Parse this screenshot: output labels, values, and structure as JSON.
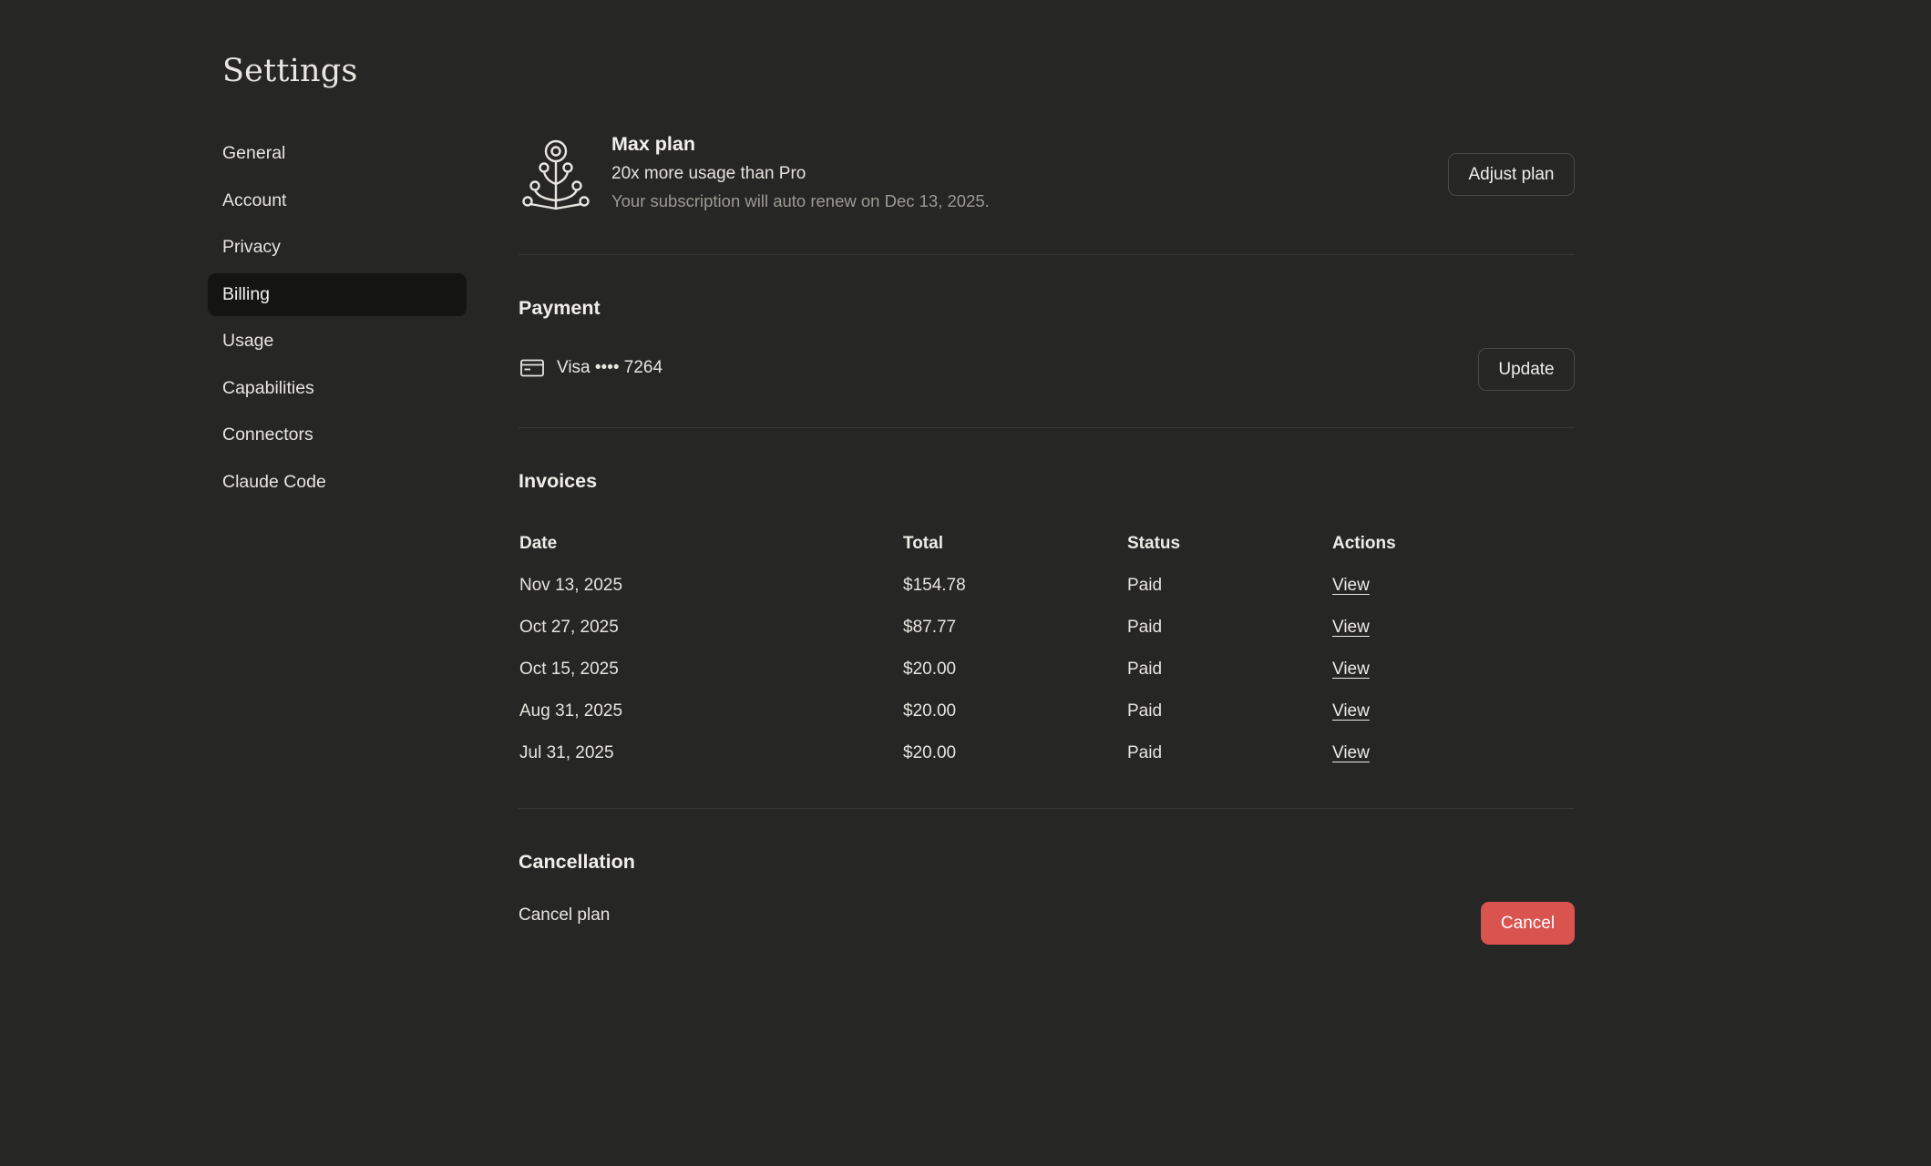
{
  "page": {
    "title": "Settings"
  },
  "sidebar": {
    "items": [
      {
        "label": "General"
      },
      {
        "label": "Account"
      },
      {
        "label": "Privacy"
      },
      {
        "label": "Billing"
      },
      {
        "label": "Usage"
      },
      {
        "label": "Capabilities"
      },
      {
        "label": "Connectors"
      },
      {
        "label": "Claude Code"
      }
    ],
    "active_item": "Billing"
  },
  "plan": {
    "name": "Max plan",
    "description": "20x more usage than Pro",
    "renewal": "Your subscription will auto renew on Dec 13, 2025.",
    "adjust_label": "Adjust plan",
    "icon": "plan-tree-icon"
  },
  "payment": {
    "title": "Payment",
    "card_icon": "credit-card-icon",
    "card_text": "Visa •••• 7264",
    "update_label": "Update"
  },
  "invoices": {
    "title": "Invoices",
    "headers": {
      "date": "Date",
      "total": "Total",
      "status": "Status",
      "actions": "Actions"
    },
    "rows": [
      {
        "date": "Nov 13, 2025",
        "total": "$154.78",
        "status": "Paid",
        "action": "View"
      },
      {
        "date": "Oct 27, 2025",
        "total": "$87.77",
        "status": "Paid",
        "action": "View"
      },
      {
        "date": "Oct 15, 2025",
        "total": "$20.00",
        "status": "Paid",
        "action": "View"
      },
      {
        "date": "Aug 31, 2025",
        "total": "$20.00",
        "status": "Paid",
        "action": "View"
      },
      {
        "date": "Jul 31, 2025",
        "total": "$20.00",
        "status": "Paid",
        "action": "View"
      }
    ]
  },
  "cancellation": {
    "title": "Cancellation",
    "label": "Cancel plan",
    "button_label": "Cancel"
  },
  "colors": {
    "background": "#262624",
    "active_item": "#141413",
    "danger": "#d9534f"
  }
}
